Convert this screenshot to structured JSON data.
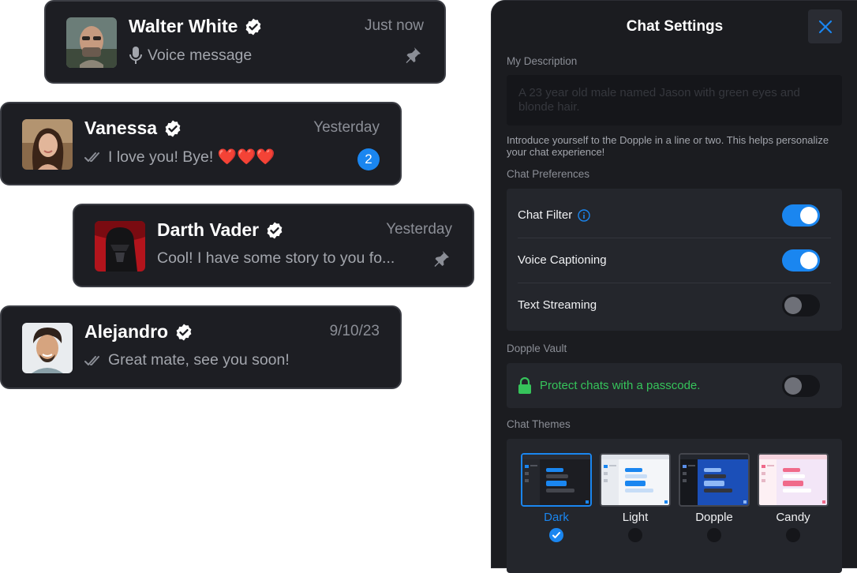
{
  "chats": [
    {
      "name": "Walter White",
      "time": "Just now",
      "message": "Voice message",
      "message_icon": "microphone-icon",
      "pinned": true,
      "unread": null,
      "read_receipt": false
    },
    {
      "name": "Vanessa",
      "time": "Yesterday",
      "message": "I love you! Bye! ❤️❤️❤️",
      "pinned": false,
      "unread": "2",
      "read_receipt": true
    },
    {
      "name": "Darth Vader",
      "time": "Yesterday",
      "message": "Cool! I have some story to you fo...",
      "pinned": true,
      "unread": null,
      "read_receipt": false
    },
    {
      "name": "Alejandro",
      "time": "9/10/23",
      "message": "Great mate, see you soon!",
      "pinned": false,
      "unread": null,
      "read_receipt": true
    }
  ],
  "settings": {
    "title": "Chat Settings",
    "description_label": "My Description",
    "description_placeholder": "A 23 year old male named Jason with green eyes and blonde hair.",
    "description_helper": "Introduce yourself to the Dopple in a line or two. This helps personalize your chat experience!",
    "preferences_label": "Chat Preferences",
    "preferences": [
      {
        "label": "Chat Filter",
        "on": true,
        "info": true
      },
      {
        "label": "Voice Captioning",
        "on": true,
        "info": false
      },
      {
        "label": "Text Streaming",
        "on": false,
        "info": false
      }
    ],
    "vault_label": "Dopple Vault",
    "vault_text": "Protect chats with a passcode.",
    "vault_on": false,
    "themes_label": "Chat Themes",
    "themes": [
      {
        "name": "Dark",
        "selected": true
      },
      {
        "name": "Light",
        "selected": false
      },
      {
        "name": "Dopple",
        "selected": false
      },
      {
        "name": "Candy",
        "selected": false
      }
    ]
  },
  "colors": {
    "accent": "#1a86f0",
    "card_bg": "#1d1e23",
    "panel_bg": "#1b1c20",
    "vault_green": "#36c45b",
    "badge": "#1a86f0"
  }
}
